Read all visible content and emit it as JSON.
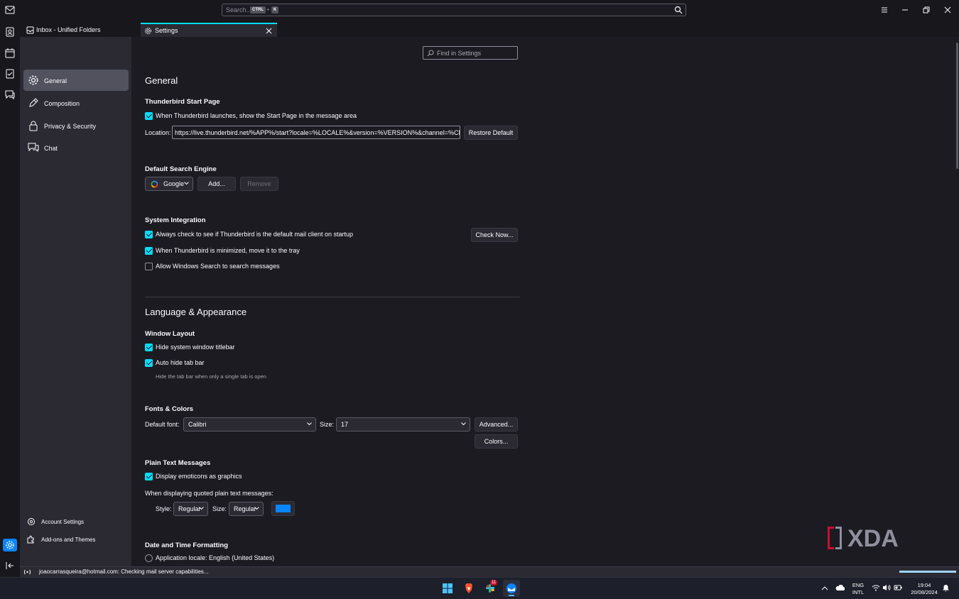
{
  "search": {
    "placeholder": "Search...",
    "kbd_ctrl": "CTRL",
    "kbd_plus": "+",
    "kbd_key": "K"
  },
  "tabs": [
    {
      "label": "Inbox - Unified Folders",
      "active": false
    },
    {
      "label": "Settings",
      "active": true
    }
  ],
  "nav": {
    "items": [
      {
        "label": "General",
        "icon": "gear-icon",
        "active": true
      },
      {
        "label": "Composition",
        "icon": "pencil-icon",
        "active": false
      },
      {
        "label": "Privacy & Security",
        "icon": "lock-icon",
        "active": false
      },
      {
        "label": "Chat",
        "icon": "chat-icon",
        "active": false
      }
    ],
    "bottom": [
      {
        "label": "Account Settings",
        "icon": "account-settings-icon"
      },
      {
        "label": "Add-ons and Themes",
        "icon": "puzzle-icon"
      }
    ]
  },
  "find": {
    "placeholder": "Find in Settings"
  },
  "general": {
    "title": "General",
    "start_page": {
      "heading": "Thunderbird Start Page",
      "checkbox": "When Thunderbird launches, show the Start Page in the message area",
      "checked": true,
      "location_label": "Location:",
      "location_value": "https://live.thunderbird.net/%APP%/start?locale=%LOCALE%&version=%VERSION%&channel=%CHANNEL%",
      "restore_button": "Restore Default"
    },
    "search_engine": {
      "heading": "Default Search Engine",
      "selected": "Google",
      "add_button": "Add...",
      "remove_button": "Remove"
    },
    "system": {
      "heading": "System Integration",
      "items": [
        {
          "label": "Always check to see if Thunderbird is the default mail client on startup",
          "checked": true
        },
        {
          "label": "When Thunderbird is minimized, move it to the tray",
          "checked": true
        },
        {
          "label": "Allow Windows Search to search messages",
          "checked": false
        }
      ],
      "check_now_button": "Check Now..."
    }
  },
  "language": {
    "title": "Language & Appearance",
    "window_layout": {
      "heading": "Window Layout",
      "items": [
        {
          "label": "Hide system window titlebar",
          "checked": true
        },
        {
          "label": "Auto hide tab bar",
          "checked": true
        }
      ],
      "hint": "Hide the tab bar when only a single tab is open"
    },
    "fonts": {
      "heading": "Fonts & Colors",
      "font_label": "Default font:",
      "font_value": "Calibri",
      "size_label": "Size:",
      "size_value": "17",
      "advanced_button": "Advanced...",
      "colors_button": "Colors..."
    },
    "plain_text": {
      "heading": "Plain Text Messages",
      "emoticons": "Display emoticons as graphics",
      "emoticons_checked": true,
      "quoted_label": "When displaying quoted plain text messages:",
      "style_label": "Style:",
      "style_value": "Regular",
      "size_label": "Size:",
      "size_value": "Regular",
      "color": "#0a84ff"
    },
    "datetime": {
      "heading": "Date and Time Formatting",
      "option": "Application locale: English (United States)"
    }
  },
  "status": {
    "text": "joaocarrasqueira@hotmail.com: Checking mail server capabilities...",
    "progress": 1.0
  },
  "watermark": "XDA",
  "taskbar": {
    "lang_top": "ENG",
    "lang_bottom": "INTL",
    "time": "19:04",
    "date": "20/08/2024",
    "badge": "11"
  },
  "colors": {
    "accent": "#00ddff",
    "bg": "#1c1b22",
    "panel": "#2b2a33"
  }
}
